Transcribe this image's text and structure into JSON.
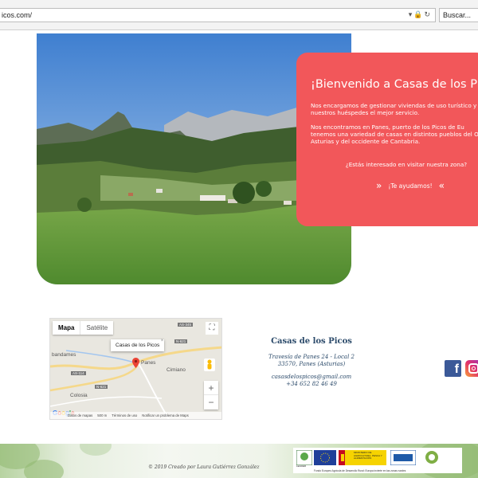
{
  "browser": {
    "url": "icos.com/",
    "search_placeholder": "Buscar..."
  },
  "hero": {
    "title": "¡Bienvenido a Casas de los Picos",
    "paragraph1": "Nos encargamos de gestionar viviendas de uso turístico y o nuestros huéspedes el mejor servicio.",
    "paragraph2": "Nos encontramos en Panes, puerto de los Picos de Eu tenemos una variedad de casas en distintos pueblos del O Asturias y del occidente de Cantabria.",
    "question": "¿Estás interesado en visitar nuestra zona?",
    "cta": "¡Te ayudamos!"
  },
  "map": {
    "tab_map": "Mapa",
    "tab_satellite": "Satélite",
    "info_title": "Casas de los Picos",
    "places": [
      "bandames",
      "Panes",
      "Cimiano",
      "Colosia"
    ],
    "roads": [
      "AS-345",
      "N-621",
      "AS-114",
      "N-621"
    ],
    "footer": [
      "Datos de mapas",
      "500 m",
      "Términos de uso",
      "Notificar un problema de Maps"
    ],
    "google": [
      "G",
      "o",
      "o",
      "g",
      "l",
      "e"
    ]
  },
  "contact": {
    "name": "Casas de los Picos",
    "address1": "Travesía de Panes 24 - Local 2",
    "address2": "33570, Panes (Asturias)",
    "email": "casasdelospicos@gmail.com",
    "phone": "+34 652 82 46 49"
  },
  "footer": {
    "credit": "© 2019 Creado por Laura Gutiérrez González",
    "leader": "LEADER",
    "ministry": "MINISTERIO DE AGRICULTURA, PESCA Y ALIMENTACIÓN",
    "fund_caption": "Fondo Europeo Agrícola de Desarrollo Rural: Europa invierte en las zonas rurales"
  },
  "colors": {
    "accent": "#f2575a",
    "contact_text": "#2b4a6a",
    "facebook": "#3b5998"
  }
}
